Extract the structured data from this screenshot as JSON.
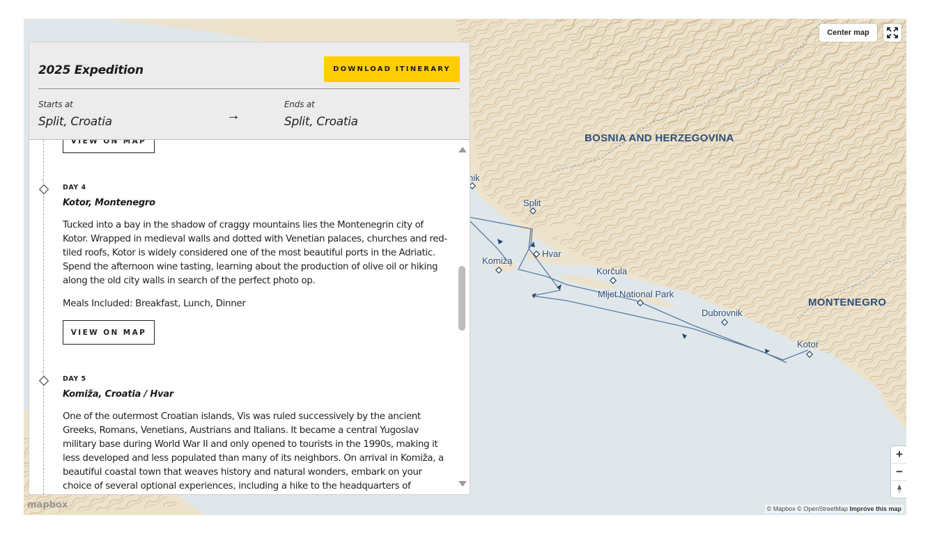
{
  "map": {
    "countries": [
      "BOSNIA AND HERZEGOVINA",
      "MONTENEGRO"
    ],
    "ports": [
      "Šibenik",
      "Split",
      "Hvar",
      "Komiža",
      "Korčula",
      "Mljet National Park",
      "Dubrovnik",
      "Kotor"
    ],
    "center_button": "Center map",
    "fullscreen_icon": "fullscreen-icon",
    "zoom_in": "+",
    "zoom_out": "−",
    "compass": "↑",
    "attribution": "© Mapbox © OpenStreetMap",
    "improve_link": "Improve this map",
    "logo_text": "mapbox",
    "colors": {
      "water": "#dfe7ea",
      "land": "#ede3cc",
      "route": "#5a7aa3",
      "label": "#2b4a73"
    }
  },
  "panel": {
    "title": "2025 Expedition",
    "download_button": "DOWNLOAD ITINERARY",
    "starts_label": "Starts at",
    "start_location": "Split, Croatia",
    "ends_label": "Ends at",
    "end_location": "Split, Croatia",
    "accent_color": "#ffce00"
  },
  "itinerary": {
    "prev_button": "VIEW ON MAP",
    "days": [
      {
        "day": "DAY 4",
        "title": "Kotor, Montenegro",
        "body": "Tucked into a bay in the shadow of craggy mountains lies the Montenegrin city of Kotor. Wrapped in medieval walls and dotted with Venetian palaces, churches and red-tiled roofs, Kotor is widely considered one of the most beautiful ports in the Adriatic. Spend the afternoon wine tasting, learning about the production of olive oil or hiking along the old city walls in search of the perfect photo op.",
        "meals": "Meals Included: Breakfast, Lunch, Dinner",
        "button": "VIEW ON MAP"
      },
      {
        "day": "DAY 5",
        "title": "Komiža, Croatia / Hvar",
        "body": "One of the outermost Croatian islands, Vis was ruled successively by the ancient Greeks, Romans, Venetians, Austrians and Italians. It became a central Yugoslav military base during World War II and only opened to tourists in the 1990s, making it less developed and less populated than many of its neighbors. On arrival in Komiža, a beautiful coastal town that weaves history and natural wonders, embark on your choice of several optional experiences, including a hike to the headquarters of Yugoslav resistance leader"
      }
    ]
  }
}
